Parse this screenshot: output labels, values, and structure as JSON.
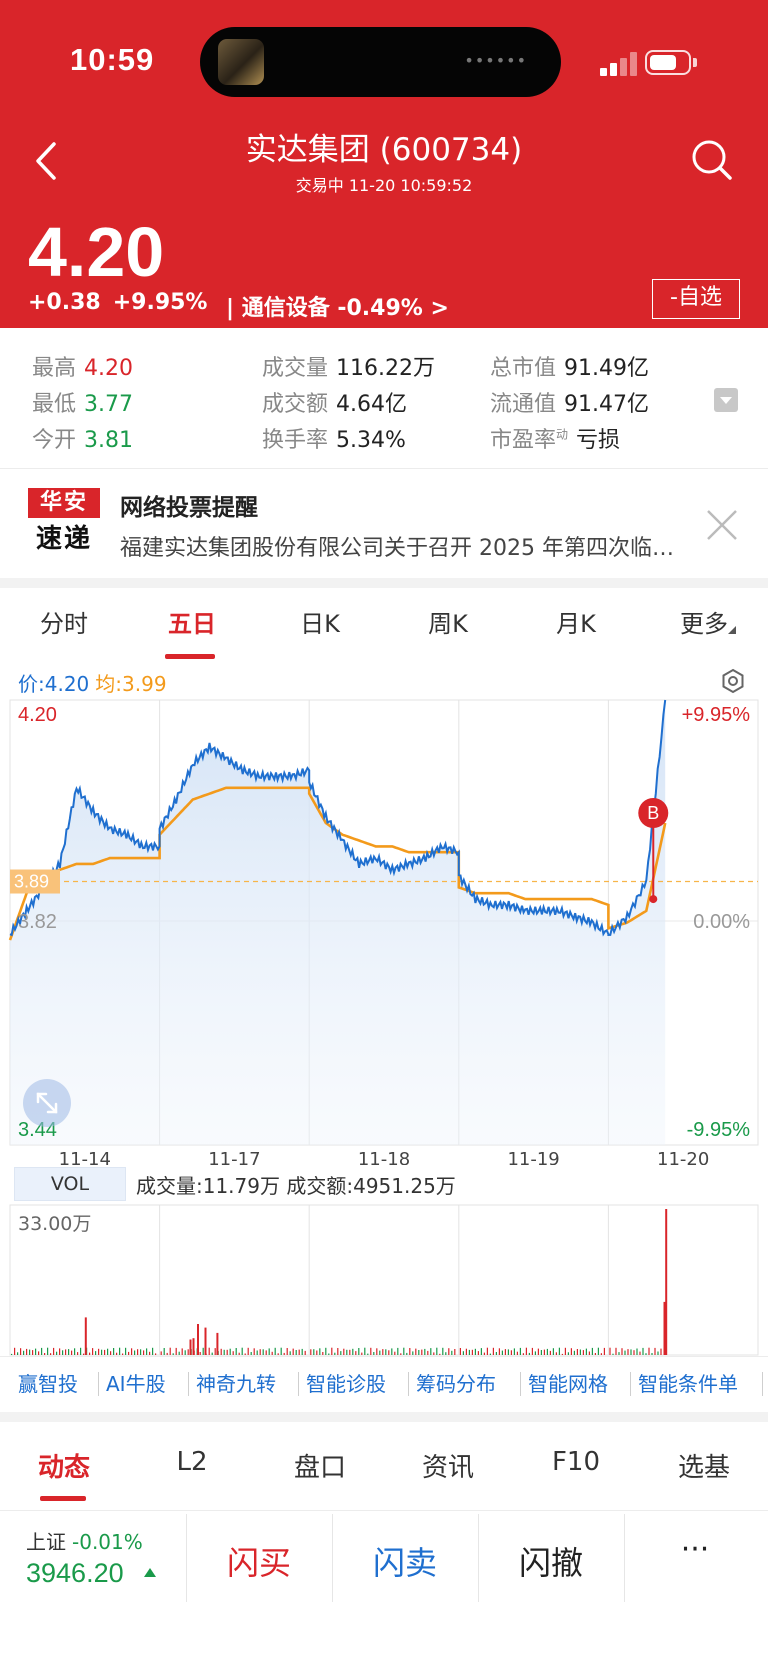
{
  "status_bar": {
    "time": "10:59"
  },
  "header": {
    "title": "实达集团 (600734)",
    "subtitle": "交易中  11-20 10:59:52"
  },
  "quote": {
    "price": "4.20",
    "change": "+0.38",
    "change_pct": "+9.95%",
    "sector": "| 通信设备 -0.49% >",
    "watchlist_label": "-自选"
  },
  "stats": {
    "high_label": "最高",
    "high": "4.20",
    "low_label": "最低",
    "low": "3.77",
    "open_label": "今开",
    "open": "3.81",
    "volume_label": "成交量",
    "volume": "116.22万",
    "turnover_label": "成交额",
    "turnover": "4.64亿",
    "turnover_rate_label": "换手率",
    "turnover_rate": "5.34%",
    "market_cap_label": "总市值",
    "market_cap": "91.49亿",
    "float_cap_label": "流通值",
    "float_cap": "91.47亿",
    "pe_label": "市盈率",
    "pe_superscript": "动",
    "pe": "亏损"
  },
  "notice": {
    "logo_top": "华安",
    "logo_bottom": "速递",
    "title": "网络投票提醒",
    "body": "福建实达集团股份有限公司关于召开 2025 年第四次临时股东大会的通知"
  },
  "chart_tabs": [
    "分时",
    "五日",
    "日K",
    "周K",
    "月K",
    "更多"
  ],
  "chart_legend": {
    "price_label": "价:4.20",
    "avg_label": "均:3.99"
  },
  "chart_labels": {
    "y_high": "4.20",
    "y_mid": "3.82",
    "y_low": "3.44",
    "pct_high": "+9.95%",
    "pct_mid": "0.00%",
    "pct_low": "-9.95%",
    "current_tag": "3.89",
    "marker": "B",
    "vol_max": "33.00万"
  },
  "chart_data": {
    "type": "line",
    "x_label_dates": [
      "11-14",
      "11-17",
      "11-18",
      "11-19",
      "11-20"
    ],
    "ylim": [
      3.44,
      4.2
    ],
    "prev_close": 3.82,
    "current_price": 3.89,
    "series": [
      {
        "name": "价",
        "color": "#1f6fcf",
        "day_points": [
          [
            3.8,
            3.84,
            3.88,
            3.92,
            4.05,
            4.01,
            3.98,
            3.97,
            3.95,
            3.95
          ],
          [
            3.98,
            4.03,
            4.09,
            4.12,
            4.1,
            4.08,
            4.07,
            4.07,
            4.07,
            4.08
          ],
          [
            4.06,
            4.0,
            3.96,
            3.92,
            3.93,
            3.91,
            3.92,
            3.93,
            3.95,
            3.94
          ],
          [
            3.9,
            3.86,
            3.85,
            3.85,
            3.84,
            3.84,
            3.84,
            3.83,
            3.82,
            3.8
          ],
          [
            3.8,
            3.83,
            3.89,
            4.2
          ]
        ]
      },
      {
        "name": "均",
        "color": "#f39a1b",
        "day_points": [
          [
            3.79,
            3.87,
            3.9,
            3.91,
            3.92,
            3.92,
            3.93,
            3.93,
            3.93,
            3.93
          ],
          [
            3.97,
            4.0,
            4.03,
            4.04,
            4.05,
            4.05,
            4.05,
            4.05,
            4.05,
            4.05
          ],
          [
            4.04,
            3.99,
            3.97,
            3.96,
            3.95,
            3.95,
            3.94,
            3.94,
            3.94,
            3.94
          ],
          [
            3.88,
            3.87,
            3.87,
            3.87,
            3.86,
            3.86,
            3.86,
            3.86,
            3.86,
            3.85
          ],
          [
            3.81,
            3.82,
            3.84,
            3.99
          ]
        ]
      }
    ],
    "volume": {
      "max": 33.0,
      "unit": "万",
      "spikes": [
        {
          "day": 0,
          "pos": 0.5,
          "value": 8.5
        },
        {
          "day": 1,
          "pos": 0.2,
          "value": 3.5
        },
        {
          "day": 1,
          "pos": 0.22,
          "value": 3.8
        },
        {
          "day": 1,
          "pos": 0.25,
          "value": 7.0
        },
        {
          "day": 1,
          "pos": 0.3,
          "value": 6.2
        },
        {
          "day": 1,
          "pos": 0.38,
          "value": 5.0
        },
        {
          "day": 4,
          "pos": 0.92,
          "value": 12.0
        },
        {
          "day": 4,
          "pos": 0.95,
          "value": 33.0
        }
      ]
    }
  },
  "volume_bar": {
    "label": "VOL",
    "info": "成交量:11.79万 成交额:4951.25万"
  },
  "ai_tools": [
    "赢智投",
    "AI牛股",
    "神奇九转",
    "智能诊股",
    "筹码分布",
    "智能网格",
    "智能条件单"
  ],
  "bottom_tabs": [
    "动态",
    "L2",
    "盘口",
    "资讯",
    "F10",
    "选基"
  ],
  "trade_bar": {
    "index_name": "上证",
    "index_change": "-0.01%",
    "index_value": "3946.20",
    "buy": "闪买",
    "sell": "闪卖",
    "cancel": "闪撤",
    "more": "···"
  },
  "colors": {
    "brand_red": "#d9252a",
    "up": "#d9252a",
    "down": "#1a9a4a",
    "price_line": "#1f6fcf",
    "avg_line": "#f39a1b"
  },
  "icons": [
    "chevron-left-icon",
    "search-icon",
    "close-icon",
    "gear-icon",
    "expand-icon"
  ]
}
